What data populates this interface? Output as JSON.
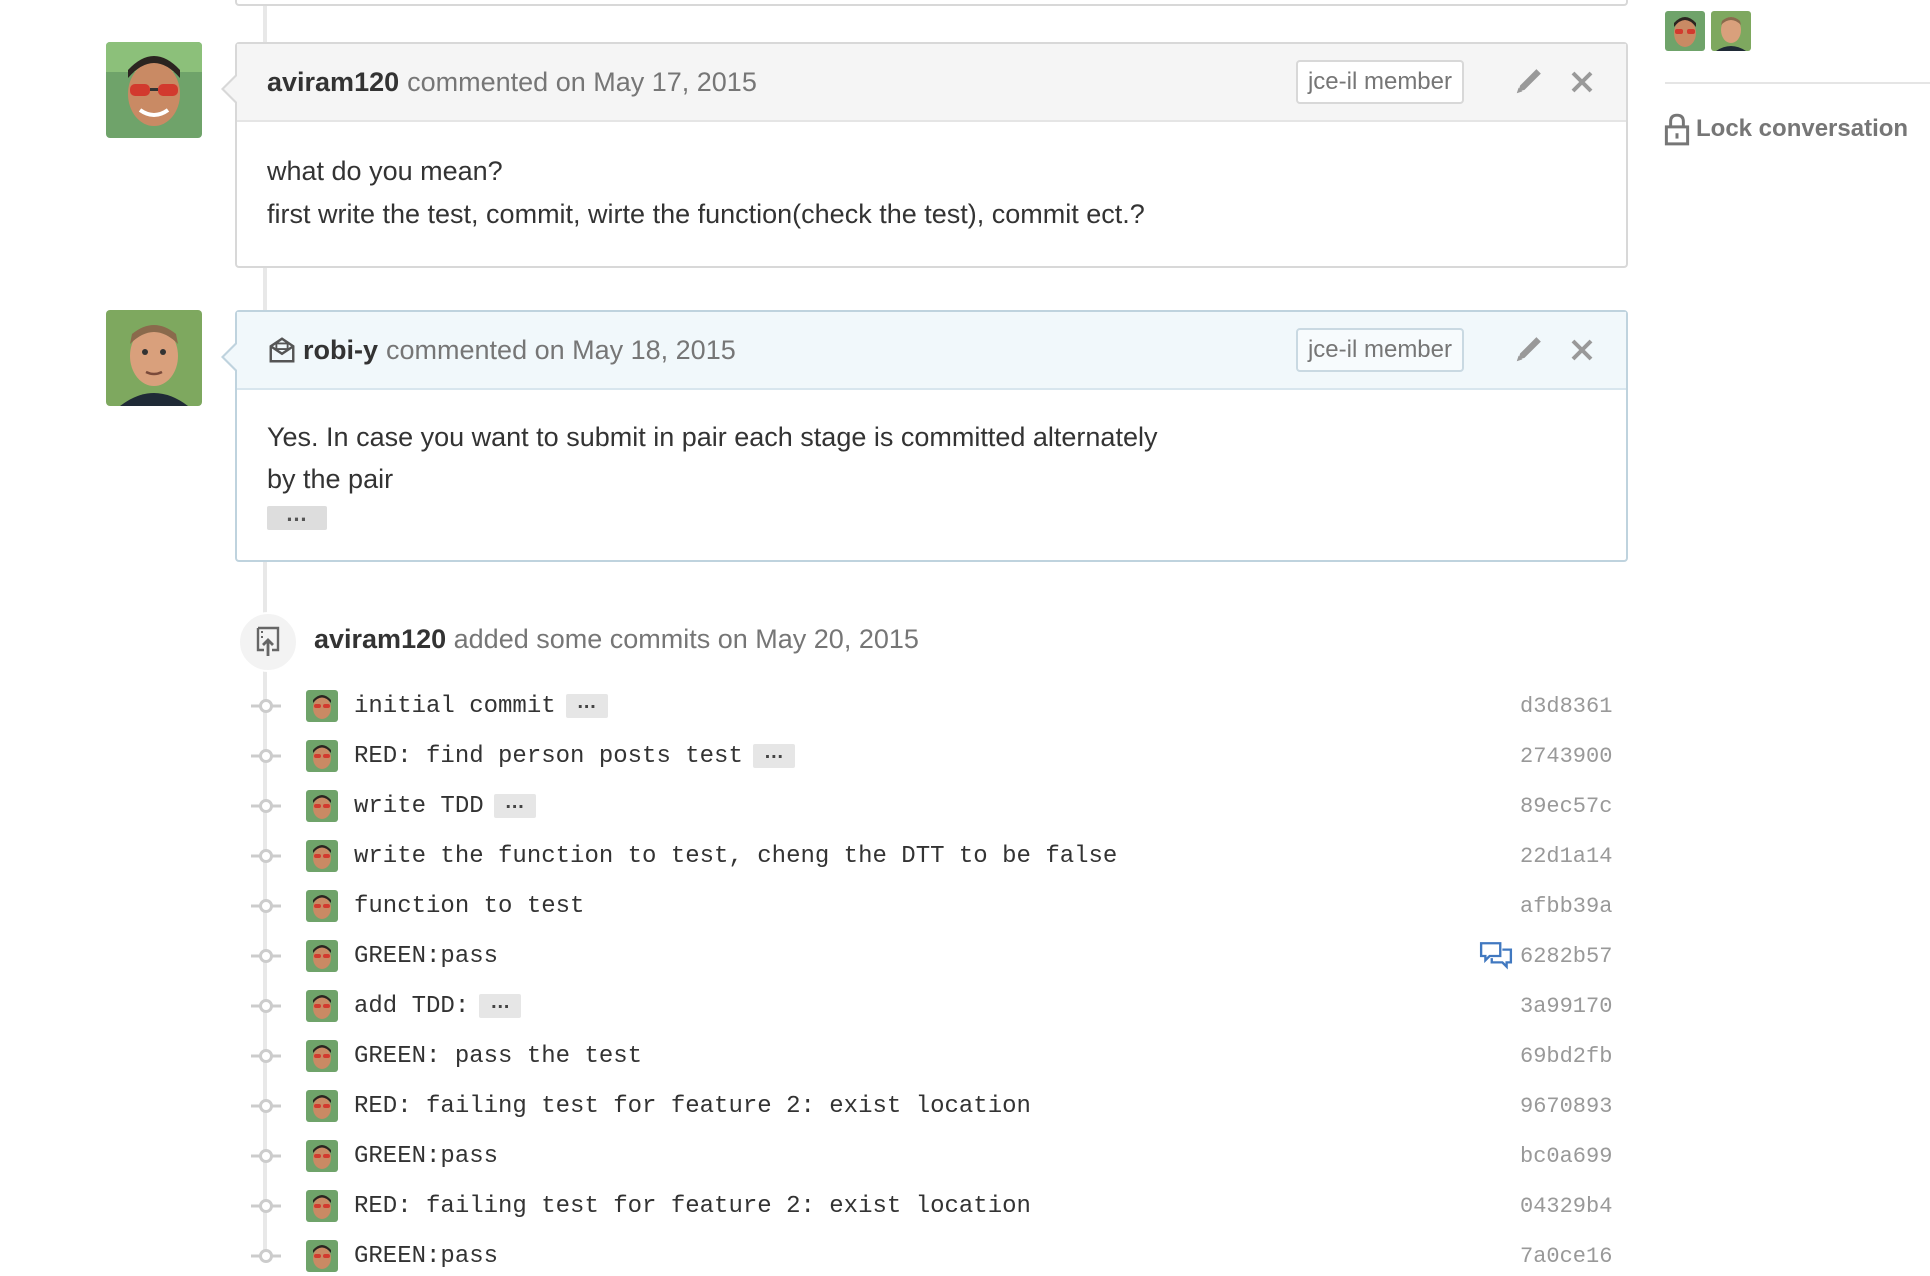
{
  "comments": [
    {
      "author": "aviram120",
      "meta": "commented on May 17, 2015",
      "badge": "jce-il member",
      "body_lines": [
        "what do you mean?",
        "first write the test, commit, wirte the function(check the test), commit ect.?"
      ]
    },
    {
      "author": "robi-y",
      "meta": "commented on May 18, 2015",
      "badge": "jce-il member",
      "body_lines": [
        "Yes. In case you want to submit in pair each stage is committed alternately",
        "by the pair"
      ],
      "ellipsis": "…"
    }
  ],
  "event": {
    "author": "aviram120",
    "text": "added some commits on May 20, 2015"
  },
  "commits": [
    {
      "message": "initial commit",
      "ellipsis": "…",
      "sha": "d3d8361"
    },
    {
      "message": "RED: find person posts test",
      "ellipsis": "…",
      "sha": "2743900"
    },
    {
      "message": "write TDD",
      "ellipsis": "…",
      "sha": "89ec57c"
    },
    {
      "message": "write the function to test, cheng the DTT to be false",
      "sha": "22d1a14"
    },
    {
      "message": "function to test",
      "sha": "afbb39a"
    },
    {
      "message": "GREEN:pass",
      "sha": "6282b57",
      "has_comments": true
    },
    {
      "message": "add TDD:",
      "ellipsis": "…",
      "sha": "3a99170"
    },
    {
      "message": "GREEN: pass the test",
      "sha": "69bd2fb"
    },
    {
      "message": "RED: failing test for feature 2: exist location",
      "sha": "9670893"
    },
    {
      "message": "GREEN:pass",
      "sha": "bc0a699"
    },
    {
      "message": "RED: failing test for feature 2: exist location",
      "sha": "04329b4"
    },
    {
      "message": "GREEN:pass",
      "sha": "7a0ce16"
    }
  ],
  "sidebar": {
    "lock_label": "Lock conversation"
  },
  "colors": {
    "link_blue": "#4078c0",
    "muted": "#767676",
    "sha": "#999999"
  },
  "icons": [
    "pencil-icon",
    "close-icon",
    "mail-icon",
    "repo-push-icon",
    "git-commit-icon",
    "comment-discussion-icon",
    "lock-icon"
  ]
}
